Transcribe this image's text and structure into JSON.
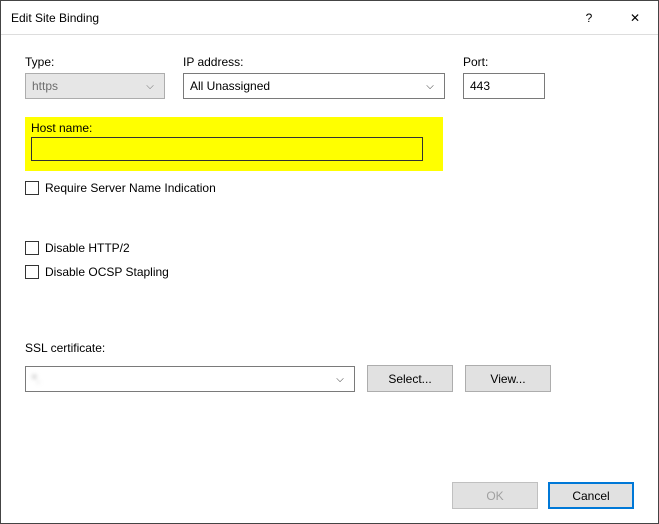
{
  "window": {
    "title": "Edit Site Binding",
    "help": "?",
    "close": "✕"
  },
  "labels": {
    "type": "Type:",
    "ip": "IP address:",
    "port": "Port:",
    "host": "Host name:",
    "sni": "Require Server Name Indication",
    "http2": "Disable HTTP/2",
    "ocsp": "Disable OCSP Stapling",
    "ssl": "SSL certificate:"
  },
  "fields": {
    "type": "https",
    "ip": "All Unassigned",
    "port": "443",
    "host": "",
    "ssl_cert": "*.                  "
  },
  "buttons": {
    "select": "Select...",
    "view": "View...",
    "ok": "OK",
    "cancel": "Cancel"
  }
}
